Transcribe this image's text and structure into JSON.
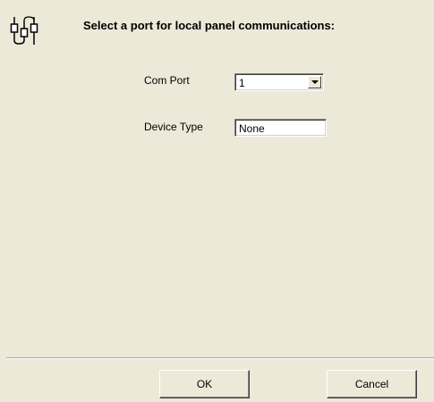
{
  "header": {
    "icon": "network-ports-icon",
    "title": "Select a port for local panel communications:"
  },
  "form": {
    "com_port": {
      "label": "Com Port",
      "value": "1"
    },
    "device_type": {
      "label": "Device Type",
      "value": "None"
    }
  },
  "buttons": {
    "ok": "OK",
    "cancel": "Cancel"
  }
}
